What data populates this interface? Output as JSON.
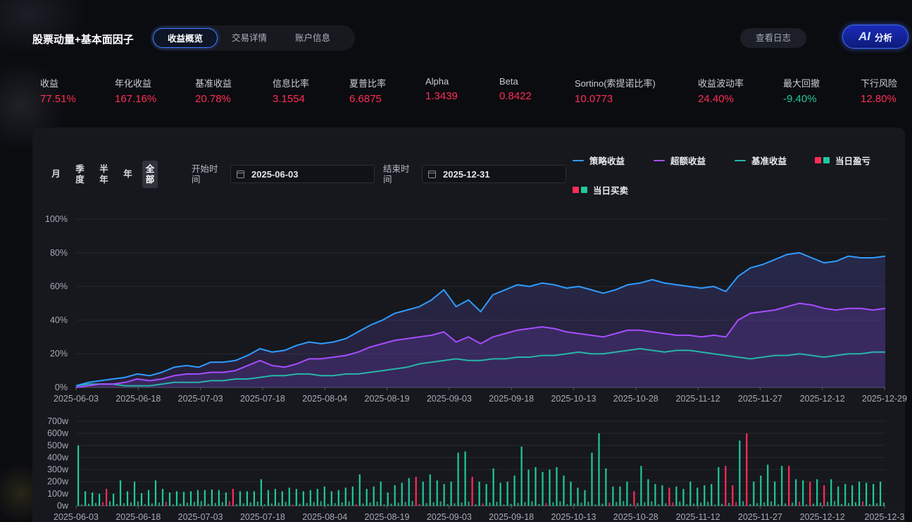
{
  "app_title": "股票动量+基本面因子",
  "tabs": [
    {
      "label": "收益概览",
      "active": true
    },
    {
      "label": "交易详情",
      "active": false
    },
    {
      "label": "账户信息",
      "active": false
    }
  ],
  "log_button": "查看日志",
  "ai_button": {
    "glyph": "AI",
    "label": "分析"
  },
  "metrics": [
    {
      "label": "收益",
      "value": "77.51%",
      "tone": "red"
    },
    {
      "label": "年化收益",
      "value": "167.16%",
      "tone": "red"
    },
    {
      "label": "基准收益",
      "value": "20.78%",
      "tone": "red"
    },
    {
      "label": "信息比率",
      "value": "3.1554",
      "tone": "red"
    },
    {
      "label": "夏普比率",
      "value": "6.6875",
      "tone": "red"
    },
    {
      "label": "Alpha",
      "value": "1.3439",
      "tone": "red"
    },
    {
      "label": "Beta",
      "value": "0.8422",
      "tone": "red"
    },
    {
      "label": "Sortino(索提诺比率)",
      "value": "10.0773",
      "tone": "red"
    },
    {
      "label": "收益波动率",
      "value": "24.40%",
      "tone": "red"
    },
    {
      "label": "最大回撤",
      "value": "-9.40%",
      "tone": "green"
    },
    {
      "label": "下行风险",
      "value": "12.80%",
      "tone": "red"
    }
  ],
  "periods": [
    {
      "label": "月",
      "active": false
    },
    {
      "label": "季度",
      "active": false
    },
    {
      "label": "半年",
      "active": false
    },
    {
      "label": "年",
      "active": false
    },
    {
      "label": "全部",
      "active": true
    }
  ],
  "start_label": "开始时间",
  "start_date": "2025-06-03",
  "end_label": "结束时间",
  "end_date": "2025-12-31",
  "legend": {
    "strategy": "策略收益",
    "excess": "超额收益",
    "benchmark": "基准收益",
    "daily_pnl": "当日盈亏",
    "daily_trade": "当日买卖"
  },
  "colors": {
    "strategy": "#2e9bff",
    "excess": "#a64dff",
    "benchmark": "#26b5a8",
    "up": "#ff2d55",
    "down": "#20c997",
    "accent": "#3f7bff"
  },
  "chart_data": [
    {
      "type": "line",
      "x_ticks": [
        "2025-06-03",
        "2025-06-18",
        "2025-07-03",
        "2025-07-18",
        "2025-08-04",
        "2025-08-19",
        "2025-09-03",
        "2025-09-18",
        "2025-10-13",
        "2025-10-28",
        "2025-11-12",
        "2025-11-27",
        "2025-12-12",
        "2025-12-29"
      ],
      "y_ticks": [
        "0%",
        "20%",
        "40%",
        "60%",
        "80%",
        "100%"
      ],
      "ylim": [
        0,
        100
      ],
      "grid": true,
      "series": [
        {
          "name": "策略收益",
          "key": "strategy",
          "values": [
            1,
            3,
            4,
            5,
            6,
            8,
            7,
            9,
            12,
            13,
            12,
            15,
            15,
            16,
            19,
            23,
            21,
            22,
            25,
            27,
            26,
            27,
            29,
            33,
            37,
            40,
            44,
            46,
            48,
            52,
            58,
            48,
            52,
            45,
            55,
            58,
            61,
            60,
            62,
            61,
            59,
            60,
            58,
            56,
            58,
            61,
            62,
            64,
            62,
            61,
            60,
            59,
            60,
            57,
            66,
            71,
            73,
            76,
            79,
            80,
            77,
            74,
            75,
            78,
            77,
            77,
            78
          ]
        },
        {
          "name": "超额收益",
          "key": "excess",
          "values": [
            0,
            1,
            2,
            2,
            3,
            5,
            4,
            5,
            7,
            8,
            8,
            9,
            9,
            10,
            13,
            16,
            13,
            12,
            14,
            17,
            17,
            18,
            19,
            21,
            24,
            26,
            28,
            29,
            30,
            31,
            33,
            27,
            30,
            26,
            30,
            32,
            34,
            35,
            36,
            35,
            33,
            32,
            31,
            30,
            32,
            34,
            34,
            33,
            32,
            31,
            31,
            30,
            31,
            30,
            40,
            44,
            45,
            46,
            48,
            50,
            49,
            47,
            46,
            47,
            47,
            46,
            47
          ]
        },
        {
          "name": "基准收益",
          "key": "benchmark",
          "values": [
            1,
            2,
            2,
            2,
            1,
            1,
            1,
            2,
            3,
            3,
            3,
            4,
            4,
            5,
            5,
            6,
            7,
            7,
            8,
            8,
            7,
            7,
            8,
            8,
            9,
            10,
            11,
            12,
            14,
            15,
            16,
            17,
            16,
            16,
            17,
            17,
            18,
            18,
            19,
            19,
            20,
            21,
            20,
            20,
            21,
            22,
            23,
            22,
            21,
            22,
            22,
            21,
            20,
            19,
            18,
            17,
            18,
            19,
            19,
            20,
            19,
            18,
            19,
            20,
            20,
            21,
            21
          ]
        }
      ]
    },
    {
      "type": "bar",
      "x_ticks": [
        "2025-06-03",
        "2025-06-18",
        "2025-07-03",
        "2025-07-18",
        "2025-08-04",
        "2025-08-19",
        "2025-09-03",
        "2025-09-18",
        "2025-10-13",
        "2025-10-28",
        "2025-11-12",
        "2025-11-27",
        "2025-12-12",
        "2025-12-3"
      ],
      "y_ticks": [
        "0w",
        "100w",
        "200w",
        "300w",
        "400w",
        "500w",
        "600w",
        "700w"
      ],
      "ylim": [
        0,
        700
      ],
      "grid": true,
      "series": [
        {
          "name": "当日买卖",
          "values": [
            500,
            120,
            110,
            100,
            140,
            100,
            210,
            120,
            200,
            105,
            130,
            210,
            140,
            110,
            120,
            115,
            120,
            130,
            130,
            135,
            130,
            110,
            140,
            120,
            120,
            120,
            220,
            130,
            140,
            120,
            150,
            140,
            120,
            130,
            140,
            160,
            120,
            130,
            150,
            160,
            260,
            140,
            160,
            200,
            110,
            170,
            190,
            230,
            240,
            200,
            260,
            210,
            180,
            200,
            440,
            450,
            240,
            200,
            180,
            310,
            190,
            200,
            250,
            490,
            300,
            320,
            280,
            300,
            320,
            250,
            200,
            150,
            130,
            440,
            600,
            310,
            160,
            160,
            200,
            120,
            330,
            220,
            180,
            170,
            150,
            160,
            140,
            200,
            150,
            170,
            180,
            320,
            330,
            170,
            540,
            600,
            200,
            250,
            340,
            200,
            330,
            330,
            220,
            210,
            200,
            220,
            170,
            220,
            160,
            180,
            170,
            200,
            190,
            180,
            200
          ]
        },
        {
          "name": "当日盈亏",
          "negative_days": [
            4,
            22,
            48,
            56,
            79,
            84,
            92,
            93,
            95,
            101,
            104,
            106
          ]
        }
      ]
    }
  ]
}
